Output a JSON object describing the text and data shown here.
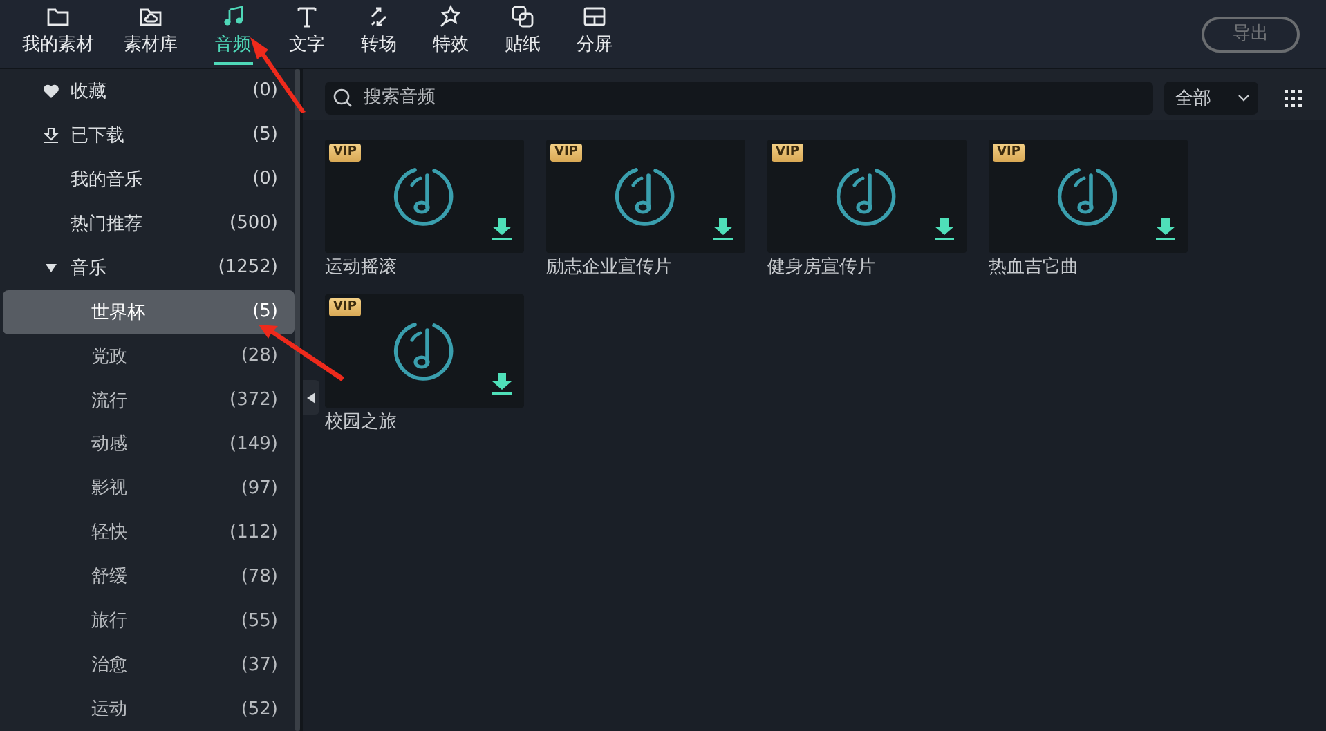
{
  "tabs": [
    {
      "label": "我的素材",
      "selected": false
    },
    {
      "label": "素材库",
      "selected": false
    },
    {
      "label": "音频",
      "selected": true
    },
    {
      "label": "文字",
      "selected": false
    },
    {
      "label": "转场",
      "selected": false
    },
    {
      "label": "特效",
      "selected": false
    },
    {
      "label": "贴纸",
      "selected": false
    },
    {
      "label": "分屏",
      "selected": false
    }
  ],
  "export_button": {
    "label": "导出",
    "disabled": true
  },
  "sidebar": {
    "items": [
      {
        "kind": "favorites",
        "label": "收藏",
        "count": "(0)",
        "selected": false
      },
      {
        "kind": "downloads",
        "label": "已下载",
        "count": "(5)",
        "selected": false
      },
      {
        "kind": "plain",
        "label": "我的音乐",
        "count": "(0)",
        "selected": false
      },
      {
        "kind": "plain",
        "label": "热门推荐",
        "count": "(500)",
        "selected": false
      },
      {
        "kind": "folder",
        "label": "音乐",
        "count": "(1252)",
        "selected": false,
        "expanded": true,
        "children": [
          {
            "label": "世界杯",
            "count": "(5)",
            "selected": true
          },
          {
            "label": "党政",
            "count": "(28)",
            "selected": false
          },
          {
            "label": "流行",
            "count": "(372)",
            "selected": false
          },
          {
            "label": "动感",
            "count": "(149)",
            "selected": false
          },
          {
            "label": "影视",
            "count": "(97)",
            "selected": false
          },
          {
            "label": "轻快",
            "count": "(112)",
            "selected": false
          },
          {
            "label": "舒缓",
            "count": "(78)",
            "selected": false
          },
          {
            "label": "旅行",
            "count": "(55)",
            "selected": false
          },
          {
            "label": "治愈",
            "count": "(37)",
            "selected": false
          },
          {
            "label": "运动",
            "count": "(52)",
            "selected": false
          }
        ]
      }
    ]
  },
  "search": {
    "placeholder": "搜索音频"
  },
  "filter": {
    "value": "全部"
  },
  "tracks": [
    {
      "title": "运动摇滚",
      "badge": "VIP"
    },
    {
      "title": "励志企业宣传片",
      "badge": "VIP"
    },
    {
      "title": "健身房宣传片",
      "badge": "VIP"
    },
    {
      "title": "热血吉它曲",
      "badge": "VIP"
    },
    {
      "title": "校园之旅",
      "badge": "VIP"
    }
  ]
}
